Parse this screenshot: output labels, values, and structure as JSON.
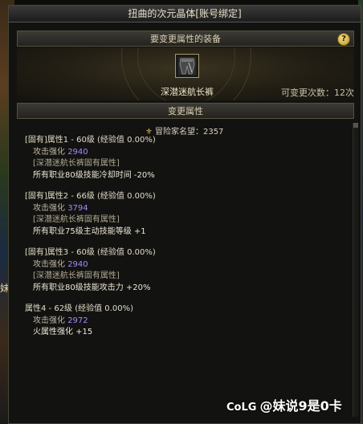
{
  "window": {
    "title": "扭曲的次元晶体[账号绑定]"
  },
  "equip_section": {
    "header": "要变更属性的装备",
    "help": "?",
    "item_name": "深潜迷航长裤",
    "change_count": "可变更次数：12次"
  },
  "change_section": {
    "header": "变更属性",
    "reputation": "冒险家名望：2357"
  },
  "attributes": [
    {
      "head": "[固有]属性1 - 60级 (经验值 0.00%)",
      "stat_label": "攻击强化",
      "stat_value": "2940",
      "set_name": "[深潜迷航长裤固有属性]",
      "effect": "所有职业80级技能冷却时间 -20%"
    },
    {
      "head": "[固有]属性2 - 66级 (经验值 0.00%)",
      "stat_label": "攻击强化",
      "stat_value": "3794",
      "set_name": "[深潜迷航长裤固有属性]",
      "effect": "所有职业75级主动技能等级 +1"
    },
    {
      "head": "[固有]属性3 - 60级 (经验值 0.00%)",
      "stat_label": "攻击强化",
      "stat_value": "2940",
      "set_name": "[深潜迷航长裤固有属性]",
      "effect": "所有职业80级技能攻击力 +20%"
    },
    {
      "head": "属性4 - 62级 (经验值 0.00%)",
      "stat_label": "攻击强化",
      "stat_value": "2972",
      "effect": "火属性强化 +15"
    }
  ],
  "background": {
    "left_glyph": "妹"
  },
  "watermark": {
    "logo": "CoLG",
    "text": "@妹说9是0卡"
  },
  "colors": {
    "stat_value": "#a888ff",
    "accent_gold": "#d8b060"
  }
}
